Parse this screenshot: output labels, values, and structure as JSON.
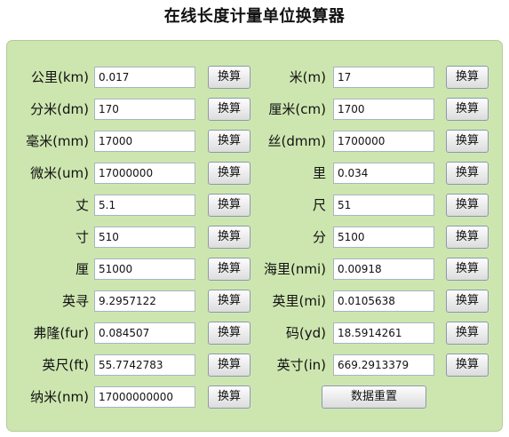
{
  "title": "在线长度计量单位换算器",
  "convert_label": "换算",
  "reset_label": "数据重置",
  "rows": [
    {
      "left": {
        "label": "公里(km)",
        "value": "0.017"
      },
      "right": {
        "label": "米(m)",
        "value": "17"
      }
    },
    {
      "left": {
        "label": "分米(dm)",
        "value": "170"
      },
      "right": {
        "label": "厘米(cm)",
        "value": "1700"
      }
    },
    {
      "left": {
        "label": "毫米(mm)",
        "value": "17000"
      },
      "right": {
        "label": "丝(dmm)",
        "value": "1700000"
      }
    },
    {
      "left": {
        "label": "微米(um)",
        "value": "17000000"
      },
      "right": {
        "label": "里",
        "value": "0.034"
      }
    },
    {
      "left": {
        "label": "丈",
        "value": "5.1"
      },
      "right": {
        "label": "尺",
        "value": "51"
      }
    },
    {
      "left": {
        "label": "寸",
        "value": "510"
      },
      "right": {
        "label": "分",
        "value": "5100"
      }
    },
    {
      "left": {
        "label": "厘",
        "value": "51000"
      },
      "right": {
        "label": "海里(nmi)",
        "value": "0.00918"
      }
    },
    {
      "left": {
        "label": "英寻",
        "value": "9.2957122"
      },
      "right": {
        "label": "英里(mi)",
        "value": "0.0105638"
      }
    },
    {
      "left": {
        "label": "弗隆(fur)",
        "value": "0.084507"
      },
      "right": {
        "label": "码(yd)",
        "value": "18.5914261"
      }
    },
    {
      "left": {
        "label": "英尺(ft)",
        "value": "55.7742783"
      },
      "right": {
        "label": "英寸(in)",
        "value": "669.2913379"
      }
    },
    {
      "left": {
        "label": "纳米(nm)",
        "value": "17000000000"
      }
    }
  ]
}
